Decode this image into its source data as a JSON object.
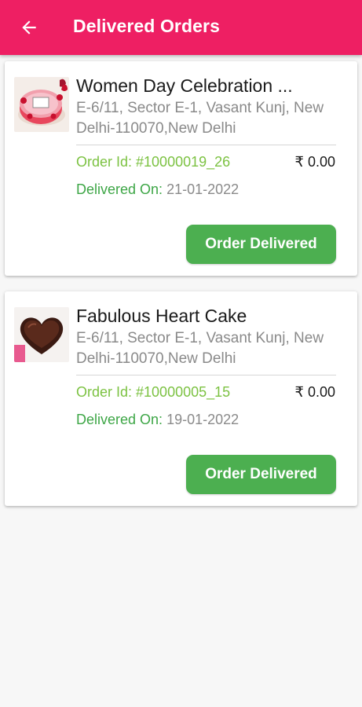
{
  "appbar": {
    "title": "Delivered Orders",
    "back_icon": "arrow-left-icon",
    "color": "#ee1f63"
  },
  "orders": [
    {
      "title": "Women Day Celebration ...",
      "address": "E-6/11, Sector E-1, Vasant Kunj, New Delhi-110070,New Delhi",
      "order_id": "Order Id: #10000019_26",
      "amount": "₹ 0.00",
      "delivered_label": "Delivered On:",
      "delivered_date": "21-01-2022",
      "status_button": "Order Delivered",
      "image_icon": "round-cake-image"
    },
    {
      "title": "Fabulous Heart Cake",
      "address": "E-6/11, Sector E-1, Vasant Kunj, New Delhi-110070,New Delhi",
      "order_id": "Order Id: #10000005_15",
      "amount": "₹ 0.00",
      "delivered_label": "Delivered On:",
      "delivered_date": "19-01-2022",
      "status_button": "Order Delivered",
      "image_icon": "heart-cake-image"
    }
  ],
  "colors": {
    "accent": "#ee1f63",
    "order_id_green": "#7cc242",
    "delivered_green": "#3da646",
    "button_green": "#4caf50"
  }
}
